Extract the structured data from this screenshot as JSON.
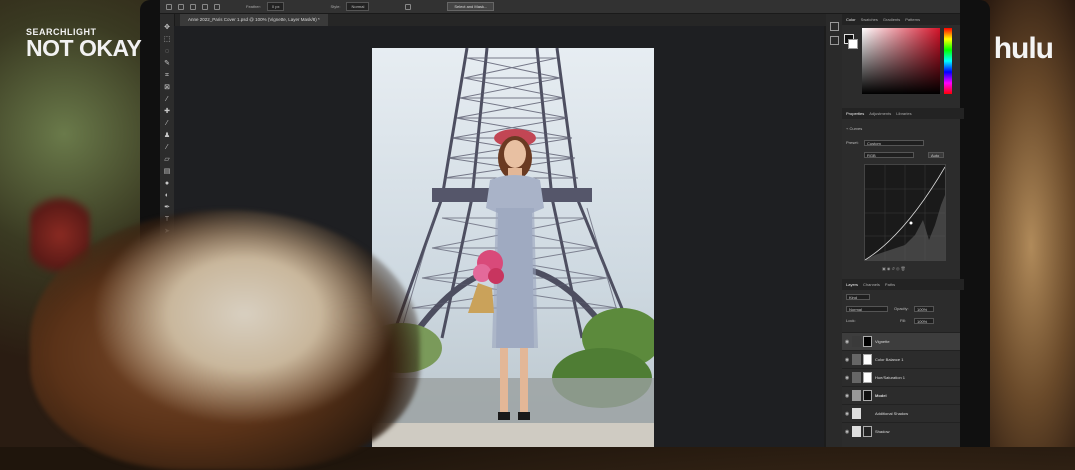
{
  "overlay": {
    "brand_top": "SEARCHLIGHT",
    "brand_title": "NOT OKAY",
    "network": "hulu"
  },
  "photoshop": {
    "options_bar": {
      "feather_label": "Feather:",
      "feather_value": "0 px",
      "style_label": "Style:",
      "style_value": "Normal",
      "select_mask_button": "Select and Mask..."
    },
    "document_tab": "Anne 2022_Paris Cover 1.psd @ 100% (Vignette, Layer Mask/8) *",
    "color_panel": {
      "tabs": [
        "Color",
        "Swatches",
        "Gradients",
        "Patterns"
      ],
      "active_tab": "Color",
      "accent": "#d4142a"
    },
    "properties_panel": {
      "tabs": [
        "Properties",
        "Adjustments",
        "Libraries"
      ],
      "active_tab": "Properties",
      "adjustment": "Curves",
      "preset_label": "Preset:",
      "preset_value": "Custom",
      "channel_value": "RGB",
      "auto_button": "Auto"
    },
    "layers_panel": {
      "tabs": [
        "Layers",
        "Channels",
        "Paths"
      ],
      "active_tab": "Layers",
      "kind_filter": "Kind",
      "blend_mode": "Normal",
      "opacity_label": "Opacity:",
      "opacity_value": "100%",
      "lock_label": "Lock:",
      "fill_label": "Fill:",
      "fill_value": "100%",
      "layers": [
        {
          "name": "Vignette",
          "active": true
        },
        {
          "name": "Color Balance 1",
          "active": false
        },
        {
          "name": "Hue/Saturation 1",
          "active": false
        },
        {
          "name": "Model",
          "active": false
        },
        {
          "name": "Additional Shadow",
          "active": false
        },
        {
          "name": "Shadow",
          "active": false
        }
      ]
    }
  }
}
